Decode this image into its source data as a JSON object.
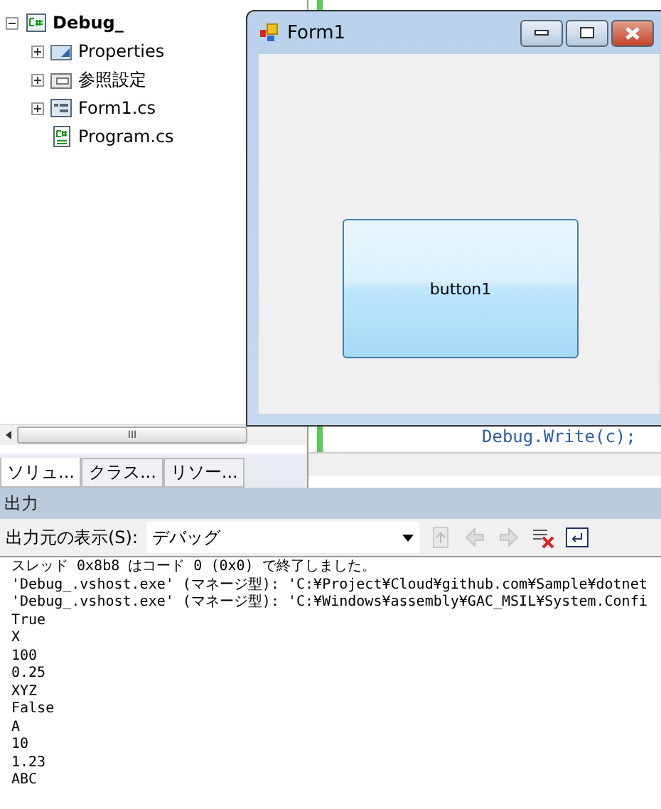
{
  "solution_explorer": {
    "tree": [
      {
        "label": "Debug_",
        "kind": "project",
        "expanded": true,
        "children": [
          {
            "label": "Properties",
            "kind": "properties",
            "expanded": false
          },
          {
            "label": "参照設定",
            "kind": "references",
            "expanded": false
          },
          {
            "label": "Form1.cs",
            "kind": "form",
            "expanded": false
          },
          {
            "label": "Program.cs",
            "kind": "code"
          }
        ]
      }
    ],
    "scroll_grip": "III",
    "tabs": [
      {
        "label": "ソリュ...",
        "selected": true
      },
      {
        "label": "クラス...",
        "selected": false
      },
      {
        "label": "リソー...",
        "selected": false
      }
    ]
  },
  "editor": {
    "lines": [
      "Debug.Write(c);"
    ]
  },
  "form_window": {
    "title": "Form1",
    "button": "button1"
  },
  "output": {
    "title": "出力",
    "source_label": "出力元の表示(S):",
    "source_value": "デバッグ",
    "tools": [
      {
        "kind": "goto",
        "disabled": true
      },
      {
        "kind": "prev",
        "disabled": true
      },
      {
        "kind": "next",
        "disabled": true
      },
      {
        "kind": "clear",
        "disabled": false
      },
      {
        "kind": "wrap",
        "disabled": false
      }
    ],
    "lines": [
      "スレッド 0x8b8 はコード 0 (0x0) で終了しました。",
      "'Debug_.vshost.exe' (マネージ型): 'C:¥Project¥Cloud¥github.com¥Sample¥dotnet",
      "'Debug_.vshost.exe' (マネージ型): 'C:¥Windows¥assembly¥GAC_MSIL¥System.Confi",
      "True",
      "X",
      "100",
      "0.25",
      "XYZ",
      "False",
      "A",
      "10",
      "1.23",
      "ABC"
    ]
  }
}
